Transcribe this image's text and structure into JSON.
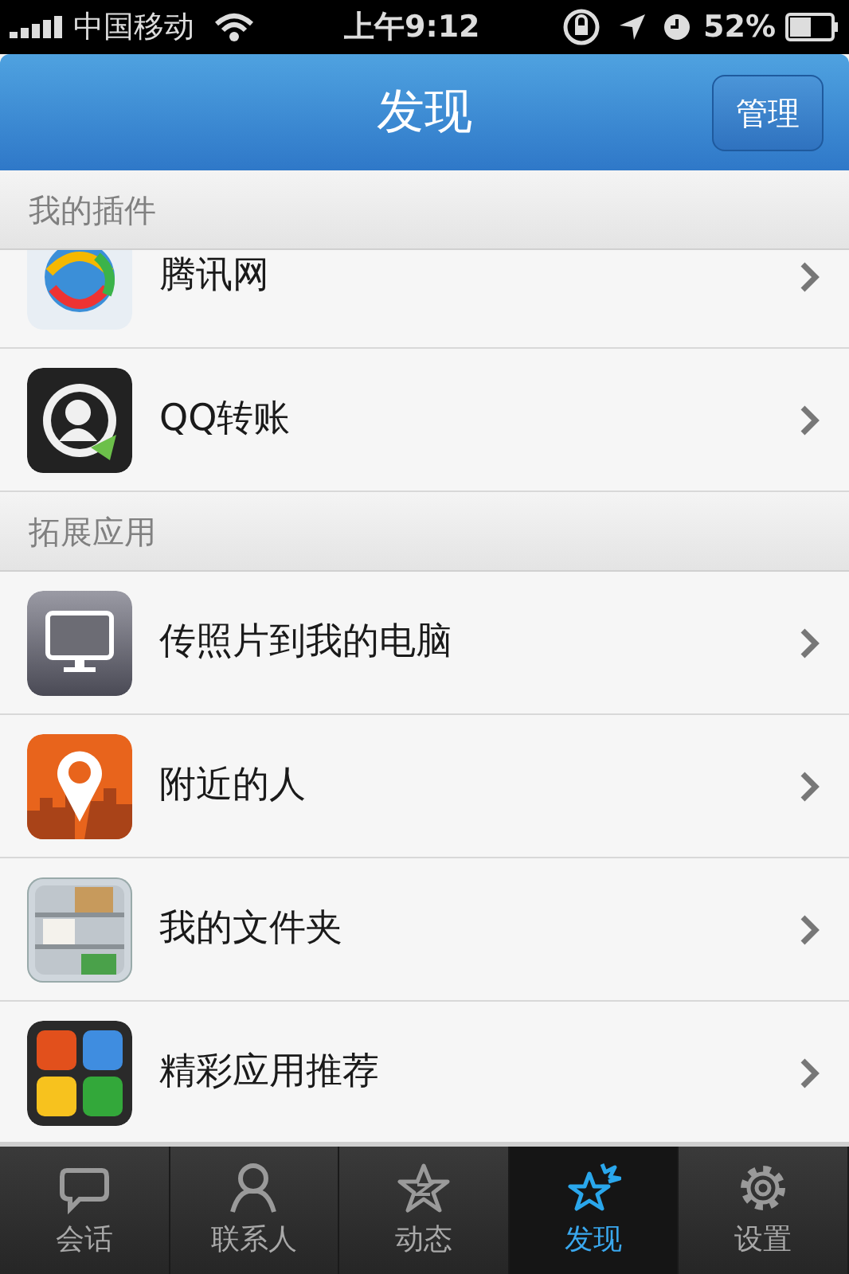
{
  "status_bar": {
    "carrier": "中国移动",
    "time": "上午9:12",
    "battery": "52%"
  },
  "nav": {
    "title": "发现",
    "action": "管理"
  },
  "sections": [
    {
      "title": "我的插件",
      "items": [
        {
          "label": "腾讯网",
          "kind": "news",
          "partial": true
        },
        {
          "label": "QQ转账",
          "kind": "transfer",
          "partial": false
        }
      ]
    },
    {
      "title": "拓展应用",
      "items": [
        {
          "label": "传照片到我的电脑",
          "kind": "computer",
          "partial": false
        },
        {
          "label": "附近的人",
          "kind": "nearby",
          "partial": false
        },
        {
          "label": "我的文件夹",
          "kind": "folder",
          "partial": false
        },
        {
          "label": "精彩应用推荐",
          "kind": "apps",
          "partial": false
        }
      ]
    }
  ],
  "tabs": [
    {
      "label": "会话",
      "kind": "chat",
      "selected": false
    },
    {
      "label": "联系人",
      "kind": "contact",
      "selected": false
    },
    {
      "label": "动态",
      "kind": "feed",
      "selected": false
    },
    {
      "label": "发现",
      "kind": "discover",
      "selected": true
    },
    {
      "label": "设置",
      "kind": "settings",
      "selected": false
    }
  ]
}
